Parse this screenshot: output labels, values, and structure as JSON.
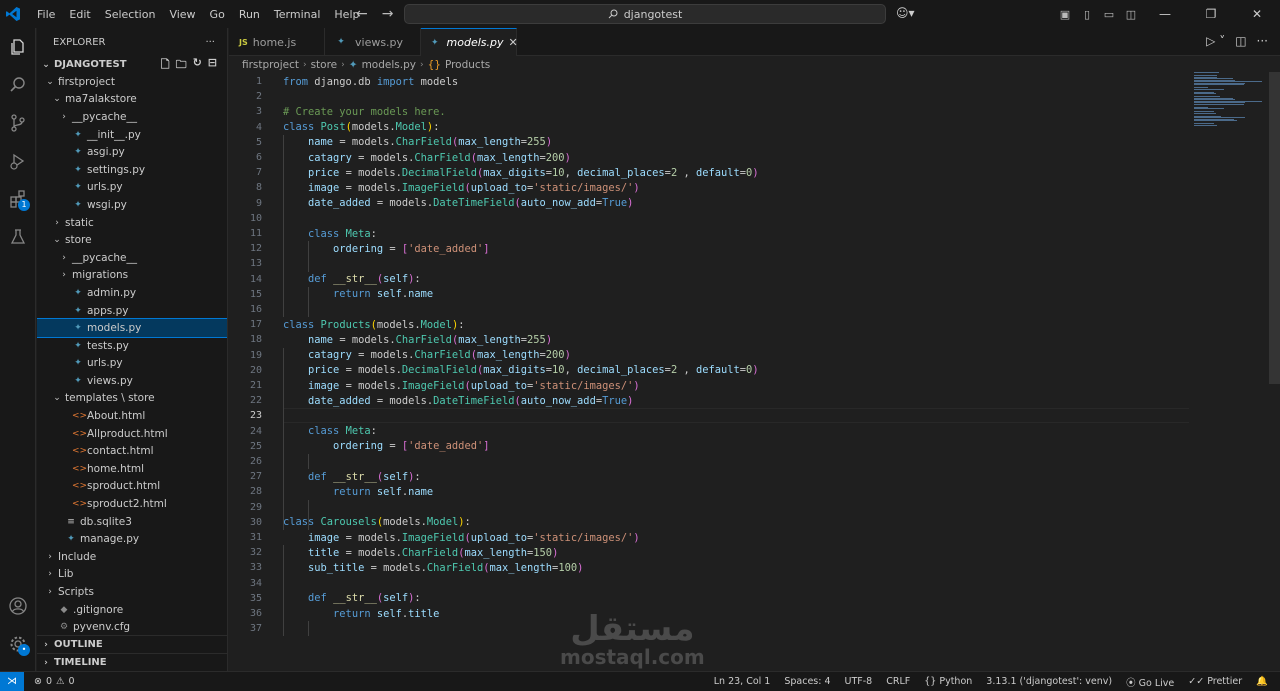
{
  "titlebar": {
    "menu": [
      "File",
      "Edit",
      "Selection",
      "View",
      "Go",
      "Run",
      "Terminal",
      "Help"
    ],
    "search": "djangotest"
  },
  "activity": {
    "extensions_badge": "1"
  },
  "explorer": {
    "header": "EXPLORER",
    "more": "···",
    "root": "DJANGOTEST",
    "tree": [
      {
        "label": "firstproject",
        "depth": 1,
        "type": "folder-open"
      },
      {
        "label": "ma7alakstore",
        "depth": 2,
        "type": "folder-open"
      },
      {
        "label": "__pycache__",
        "depth": 3,
        "type": "folder"
      },
      {
        "label": "__init__.py",
        "depth": 3,
        "type": "py"
      },
      {
        "label": "asgi.py",
        "depth": 3,
        "type": "py"
      },
      {
        "label": "settings.py",
        "depth": 3,
        "type": "py"
      },
      {
        "label": "urls.py",
        "depth": 3,
        "type": "py"
      },
      {
        "label": "wsgi.py",
        "depth": 3,
        "type": "py"
      },
      {
        "label": "static",
        "depth": 2,
        "type": "folder"
      },
      {
        "label": "store",
        "depth": 2,
        "type": "folder-open"
      },
      {
        "label": "__pycache__",
        "depth": 3,
        "type": "folder"
      },
      {
        "label": "migrations",
        "depth": 3,
        "type": "folder"
      },
      {
        "label": "admin.py",
        "depth": 3,
        "type": "py"
      },
      {
        "label": "apps.py",
        "depth": 3,
        "type": "py"
      },
      {
        "label": "models.py",
        "depth": 3,
        "type": "py",
        "selected": true
      },
      {
        "label": "tests.py",
        "depth": 3,
        "type": "py"
      },
      {
        "label": "urls.py",
        "depth": 3,
        "type": "py"
      },
      {
        "label": "views.py",
        "depth": 3,
        "type": "py"
      },
      {
        "label": "templates \\ store",
        "depth": 2,
        "type": "folder-open"
      },
      {
        "label": "About.html",
        "depth": 3,
        "type": "html"
      },
      {
        "label": "Allproduct.html",
        "depth": 3,
        "type": "html"
      },
      {
        "label": "contact.html",
        "depth": 3,
        "type": "html"
      },
      {
        "label": "home.html",
        "depth": 3,
        "type": "html"
      },
      {
        "label": "sproduct.html",
        "depth": 3,
        "type": "html"
      },
      {
        "label": "sproduct2.html",
        "depth": 3,
        "type": "html"
      },
      {
        "label": "db.sqlite3",
        "depth": 2,
        "type": "db"
      },
      {
        "label": "manage.py",
        "depth": 2,
        "type": "py"
      },
      {
        "label": "Include",
        "depth": 1,
        "type": "folder"
      },
      {
        "label": "Lib",
        "depth": 1,
        "type": "folder"
      },
      {
        "label": "Scripts",
        "depth": 1,
        "type": "folder"
      },
      {
        "label": ".gitignore",
        "depth": 1,
        "type": "git"
      },
      {
        "label": "pyvenv.cfg",
        "depth": 1,
        "type": "cfg"
      }
    ],
    "outline": "OUTLINE",
    "timeline": "TIMELINE"
  },
  "tabs": [
    {
      "label": "home.js",
      "icon": "JS"
    },
    {
      "label": "views.py",
      "icon": "py"
    },
    {
      "label": "models.py",
      "icon": "py",
      "active": true
    }
  ],
  "breadcrumb": [
    "firstproject",
    "store",
    "models.py",
    "Products"
  ],
  "code": [
    [
      [
        "k",
        "from "
      ],
      [
        "t",
        "django.db "
      ],
      [
        "k",
        "import "
      ],
      [
        "t",
        "models"
      ]
    ],
    [],
    [
      [
        "cm",
        "# Create your models here."
      ]
    ],
    [
      [
        "k",
        "class "
      ],
      [
        "c",
        "Post"
      ],
      [
        "b1",
        "("
      ],
      [
        "t",
        "models."
      ],
      [
        "c",
        "Model"
      ],
      [
        "b1",
        ")"
      ],
      [
        "t",
        ":"
      ]
    ],
    [
      [
        "ind",
        "    "
      ],
      [
        "p",
        "name"
      ],
      [
        "t",
        " = models."
      ],
      [
        "c",
        "CharField"
      ],
      [
        "b2",
        "("
      ],
      [
        "p",
        "max_length"
      ],
      [
        "t",
        "="
      ],
      [
        "n",
        "255"
      ],
      [
        "b2",
        ")"
      ]
    ],
    [
      [
        "ind",
        "    "
      ],
      [
        "p",
        "catagry"
      ],
      [
        "t",
        " = models."
      ],
      [
        "c",
        "CharField"
      ],
      [
        "b2",
        "("
      ],
      [
        "p",
        "max_length"
      ],
      [
        "t",
        "="
      ],
      [
        "n",
        "200"
      ],
      [
        "b2",
        ")"
      ]
    ],
    [
      [
        "ind",
        "    "
      ],
      [
        "p",
        "price"
      ],
      [
        "t",
        " = models."
      ],
      [
        "c",
        "DecimalField"
      ],
      [
        "b2",
        "("
      ],
      [
        "p",
        "max_digits"
      ],
      [
        "t",
        "="
      ],
      [
        "n",
        "10"
      ],
      [
        "t",
        ", "
      ],
      [
        "p",
        "decimal_places"
      ],
      [
        "t",
        "="
      ],
      [
        "n",
        "2"
      ],
      [
        "t",
        " , "
      ],
      [
        "p",
        "default"
      ],
      [
        "t",
        "="
      ],
      [
        "n",
        "0"
      ],
      [
        "b2",
        ")"
      ]
    ],
    [
      [
        "ind",
        "    "
      ],
      [
        "p",
        "image"
      ],
      [
        "t",
        " = models."
      ],
      [
        "c",
        "ImageField"
      ],
      [
        "b2",
        "("
      ],
      [
        "p",
        "upload_to"
      ],
      [
        "t",
        "="
      ],
      [
        "s",
        "'static/images/'"
      ],
      [
        "b2",
        ")"
      ]
    ],
    [
      [
        "ind",
        "    "
      ],
      [
        "p",
        "date_added"
      ],
      [
        "t",
        " = models."
      ],
      [
        "c",
        "DateTimeField"
      ],
      [
        "b2",
        "("
      ],
      [
        "p",
        "auto_now_add"
      ],
      [
        "t",
        "="
      ],
      [
        "k",
        "True"
      ],
      [
        "b2",
        ")"
      ]
    ],
    [],
    [
      [
        "ind",
        "    "
      ],
      [
        "k",
        "class "
      ],
      [
        "c",
        "Meta"
      ],
      [
        "t",
        ":"
      ]
    ],
    [
      [
        "ind",
        "        "
      ],
      [
        "p",
        "ordering"
      ],
      [
        "t",
        " = "
      ],
      [
        "b2",
        "["
      ],
      [
        "s",
        "'date_added'"
      ],
      [
        "b2",
        "]"
      ]
    ],
    [],
    [
      [
        "ind",
        "    "
      ],
      [
        "k",
        "def "
      ],
      [
        "f",
        "__str__"
      ],
      [
        "b2",
        "("
      ],
      [
        "p",
        "self"
      ],
      [
        "b2",
        ")"
      ],
      [
        "t",
        ":"
      ]
    ],
    [
      [
        "ind",
        "        "
      ],
      [
        "k",
        "return "
      ],
      [
        "p",
        "self"
      ],
      [
        "t",
        "."
      ],
      [
        "p",
        "name"
      ]
    ],
    [],
    [
      [
        "k",
        "class "
      ],
      [
        "c",
        "Products"
      ],
      [
        "b1",
        "("
      ],
      [
        "t",
        "models."
      ],
      [
        "c",
        "Model"
      ],
      [
        "b1",
        ")"
      ],
      [
        "t",
        ":"
      ]
    ],
    [
      [
        "ind",
        "    "
      ],
      [
        "p",
        "name"
      ],
      [
        "t",
        " = models."
      ],
      [
        "c",
        "CharField"
      ],
      [
        "b2",
        "("
      ],
      [
        "p",
        "max_length"
      ],
      [
        "t",
        "="
      ],
      [
        "n",
        "255"
      ],
      [
        "b2",
        ")"
      ]
    ],
    [
      [
        "ind",
        "    "
      ],
      [
        "p",
        "catagry"
      ],
      [
        "t",
        " = models."
      ],
      [
        "c",
        "CharField"
      ],
      [
        "b2",
        "("
      ],
      [
        "p",
        "max_length"
      ],
      [
        "t",
        "="
      ],
      [
        "n",
        "200"
      ],
      [
        "b2",
        ")"
      ]
    ],
    [
      [
        "ind",
        "    "
      ],
      [
        "p",
        "price"
      ],
      [
        "t",
        " = models."
      ],
      [
        "c",
        "DecimalField"
      ],
      [
        "b2",
        "("
      ],
      [
        "p",
        "max_digits"
      ],
      [
        "t",
        "="
      ],
      [
        "n",
        "10"
      ],
      [
        "t",
        ", "
      ],
      [
        "p",
        "decimal_places"
      ],
      [
        "t",
        "="
      ],
      [
        "n",
        "2"
      ],
      [
        "t",
        " , "
      ],
      [
        "p",
        "default"
      ],
      [
        "t",
        "="
      ],
      [
        "n",
        "0"
      ],
      [
        "b2",
        ")"
      ]
    ],
    [
      [
        "ind",
        "    "
      ],
      [
        "p",
        "image"
      ],
      [
        "t",
        " = models."
      ],
      [
        "c",
        "ImageField"
      ],
      [
        "b2",
        "("
      ],
      [
        "p",
        "upload_to"
      ],
      [
        "t",
        "="
      ],
      [
        "s",
        "'static/images/'"
      ],
      [
        "b2",
        ")"
      ]
    ],
    [
      [
        "ind",
        "    "
      ],
      [
        "p",
        "date_added"
      ],
      [
        "t",
        " = models."
      ],
      [
        "c",
        "DateTimeField"
      ],
      [
        "b2",
        "("
      ],
      [
        "p",
        "auto_now_add"
      ],
      [
        "t",
        "="
      ],
      [
        "k",
        "True"
      ],
      [
        "b2",
        ")"
      ]
    ],
    [],
    [
      [
        "ind",
        "    "
      ],
      [
        "k",
        "class "
      ],
      [
        "c",
        "Meta"
      ],
      [
        "t",
        ":"
      ]
    ],
    [
      [
        "ind",
        "        "
      ],
      [
        "p",
        "ordering"
      ],
      [
        "t",
        " = "
      ],
      [
        "b2",
        "["
      ],
      [
        "s",
        "'date_added'"
      ],
      [
        "b2",
        "]"
      ]
    ],
    [],
    [
      [
        "ind",
        "    "
      ],
      [
        "k",
        "def "
      ],
      [
        "f",
        "__str__"
      ],
      [
        "b2",
        "("
      ],
      [
        "p",
        "self"
      ],
      [
        "b2",
        ")"
      ],
      [
        "t",
        ":"
      ]
    ],
    [
      [
        "ind",
        "        "
      ],
      [
        "k",
        "return "
      ],
      [
        "p",
        "self"
      ],
      [
        "t",
        "."
      ],
      [
        "p",
        "name"
      ]
    ],
    [],
    [
      [
        "k",
        "class "
      ],
      [
        "c",
        "Carousels"
      ],
      [
        "b1",
        "("
      ],
      [
        "t",
        "models."
      ],
      [
        "c",
        "Model"
      ],
      [
        "b1",
        ")"
      ],
      [
        "t",
        ":"
      ]
    ],
    [
      [
        "ind",
        "    "
      ],
      [
        "p",
        "image"
      ],
      [
        "t",
        " = models."
      ],
      [
        "c",
        "ImageField"
      ],
      [
        "b2",
        "("
      ],
      [
        "p",
        "upload_to"
      ],
      [
        "t",
        "="
      ],
      [
        "s",
        "'static/images/'"
      ],
      [
        "b2",
        ")"
      ]
    ],
    [
      [
        "ind",
        "    "
      ],
      [
        "p",
        "title"
      ],
      [
        "t",
        " = models."
      ],
      [
        "c",
        "CharField"
      ],
      [
        "b2",
        "("
      ],
      [
        "p",
        "max_length"
      ],
      [
        "t",
        "="
      ],
      [
        "n",
        "150"
      ],
      [
        "b2",
        ")"
      ]
    ],
    [
      [
        "ind",
        "    "
      ],
      [
        "p",
        "sub_title"
      ],
      [
        "t",
        " = models."
      ],
      [
        "c",
        "CharField"
      ],
      [
        "b2",
        "("
      ],
      [
        "p",
        "max_length"
      ],
      [
        "t",
        "="
      ],
      [
        "n",
        "100"
      ],
      [
        "b2",
        ")"
      ]
    ],
    [],
    [
      [
        "ind",
        "    "
      ],
      [
        "k",
        "def "
      ],
      [
        "f",
        "__str__"
      ],
      [
        "b2",
        "("
      ],
      [
        "p",
        "self"
      ],
      [
        "b2",
        ")"
      ],
      [
        "t",
        ":"
      ]
    ],
    [
      [
        "ind",
        "        "
      ],
      [
        "k",
        "return "
      ],
      [
        "p",
        "self"
      ],
      [
        "t",
        "."
      ],
      [
        "p",
        "title"
      ]
    ],
    []
  ],
  "current_line": 23,
  "watermark": {
    "arabic": "مستقل",
    "latin": "mostaql.com"
  },
  "status": {
    "errors": "0",
    "warnings": "0",
    "position": "Ln 23, Col 1",
    "spaces": "Spaces: 4",
    "encoding": "UTF-8",
    "eol": "CRLF",
    "language": "Python",
    "interpreter": "3.13.1 ('djangotest': venv)",
    "golive": "Go Live",
    "prettier": "Prettier"
  }
}
